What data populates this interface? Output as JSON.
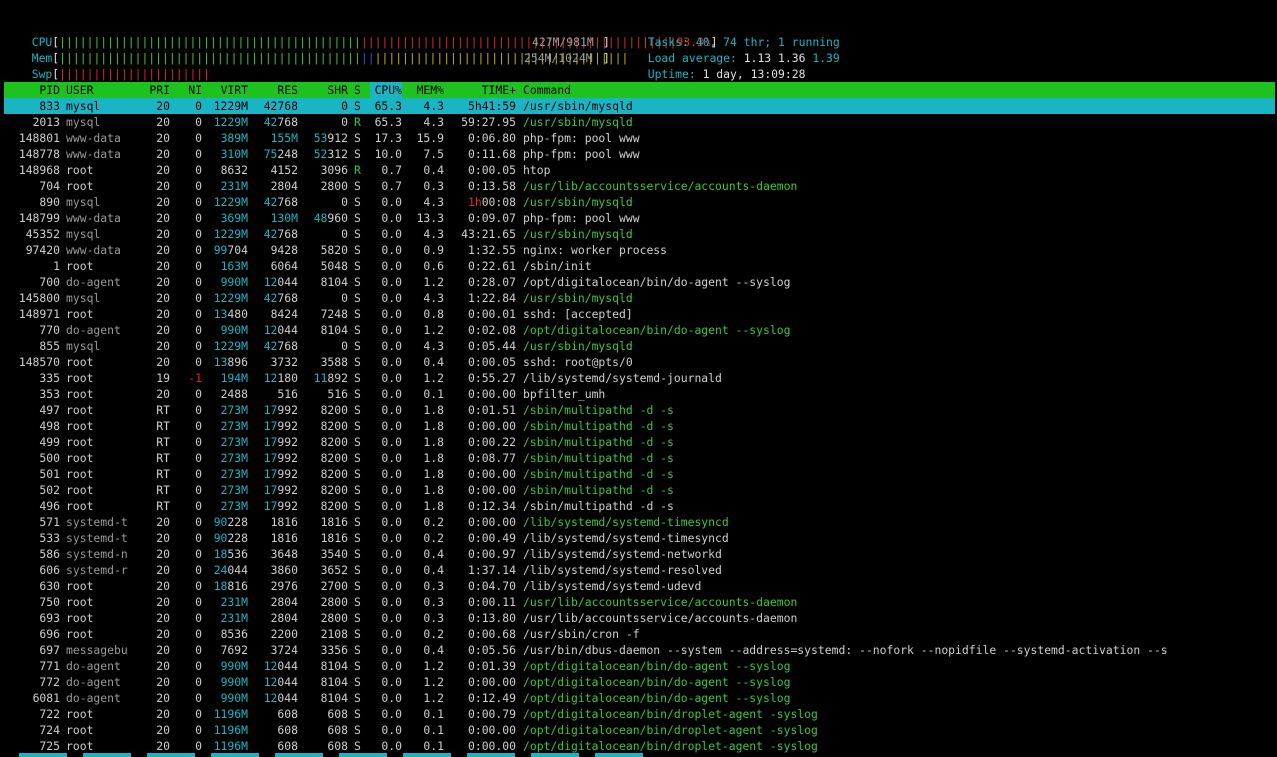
{
  "meters": {
    "cpu": {
      "label": "CPU",
      "pct": "93.3%",
      "green_bar": "||||||||||||||||||||||||||||||||||||||||||||",
      "red_bar": "||||||||||||||||||||||||||||||||||||||||||||||"
    },
    "mem": {
      "label": "Mem",
      "value": "427M/981M",
      "green_bar": "||||||||||||||||||||||||||||||||||||||||||||",
      "blue_bar": "||",
      "yellow_bar": "|||||||||||||||||||||||||||||||||||||"
    },
    "swp": {
      "label": "Swp",
      "value": "254M/1024M",
      "red_bar": "||||||||||||||||||||||"
    }
  },
  "summary": {
    "tasks_label": "Tasks: ",
    "tasks_total": "40",
    "tasks_sep1": ", ",
    "threads": "74",
    "threads_label": " thr; ",
    "running": "1",
    "running_label": " running",
    "load_label": "Load average: ",
    "load1": "1.13",
    "load5": "1.36",
    "load15": "1.39",
    "uptime_label": "Uptime: ",
    "uptime_value": "1 day, 13:09:28"
  },
  "columns": {
    "pid": "PID",
    "user": "USER",
    "pri": "PRI",
    "ni": "NI",
    "virt": "VIRT",
    "res": "RES",
    "shr": "SHR",
    "s": "S",
    "cpu": "CPU%",
    "mem": "MEM%",
    "time": "TIME+",
    "cmd": "Command"
  },
  "processes": [
    {
      "pid": "833",
      "user": "mysql",
      "pri": "20",
      "ni": "0",
      "virt": "1229M",
      "res": "42768",
      "shr": "0",
      "s": "S",
      "cpu": "65.3",
      "mem": "4.3",
      "time": "5h41:59",
      "cmd": "/usr/sbin/mysqld"
    },
    {
      "pid": "2013",
      "user": "mysql",
      "pri": "20",
      "ni": "0",
      "virt": "1229M",
      "res": "42768",
      "shr": "0",
      "s": "R",
      "cpu": "65.3",
      "mem": "4.3",
      "time": "59:27.95",
      "cmd": "/usr/sbin/mysqld"
    },
    {
      "pid": "148801",
      "user": "www-data",
      "pri": "20",
      "ni": "0",
      "virt": "389M",
      "res": "155M",
      "shr": "53912",
      "s": "S",
      "cpu": "17.3",
      "mem": "15.9",
      "time": "0:06.80",
      "cmd": "php-fpm: pool www"
    },
    {
      "pid": "148778",
      "user": "www-data",
      "pri": "20",
      "ni": "0",
      "virt": "310M",
      "res": "75248",
      "shr": "52312",
      "s": "S",
      "cpu": "10.0",
      "mem": "7.5",
      "time": "0:11.68",
      "cmd": "php-fpm: pool www"
    },
    {
      "pid": "148968",
      "user": "root",
      "pri": "20",
      "ni": "0",
      "virt": "8632",
      "res": "4152",
      "shr": "3096",
      "s": "R",
      "cpu": "0.7",
      "mem": "0.4",
      "time": "0:00.05",
      "cmd": "htop"
    },
    {
      "pid": "704",
      "user": "root",
      "pri": "20",
      "ni": "0",
      "virt": "231M",
      "res": "2804",
      "shr": "2800",
      "s": "S",
      "cpu": "0.7",
      "mem": "0.3",
      "time": "0:13.58",
      "cmd": "/usr/lib/accountsservice/accounts-daemon"
    },
    {
      "pid": "890",
      "user": "mysql",
      "pri": "20",
      "ni": "0",
      "virt": "1229M",
      "res": "42768",
      "shr": "0",
      "s": "S",
      "cpu": "0.0",
      "mem": "4.3",
      "time": "1h00:08",
      "cmd": "/usr/sbin/mysqld"
    },
    {
      "pid": "148799",
      "user": "www-data",
      "pri": "20",
      "ni": "0",
      "virt": "369M",
      "res": "130M",
      "shr": "48960",
      "s": "S",
      "cpu": "0.0",
      "mem": "13.3",
      "time": "0:09.07",
      "cmd": "php-fpm: pool www"
    },
    {
      "pid": "45352",
      "user": "mysql",
      "pri": "20",
      "ni": "0",
      "virt": "1229M",
      "res": "42768",
      "shr": "0",
      "s": "S",
      "cpu": "0.0",
      "mem": "4.3",
      "time": "43:21.65",
      "cmd": "/usr/sbin/mysqld"
    },
    {
      "pid": "97420",
      "user": "www-data",
      "pri": "20",
      "ni": "0",
      "virt": "99704",
      "res": "9428",
      "shr": "5820",
      "s": "S",
      "cpu": "0.0",
      "mem": "0.9",
      "time": "1:32.55",
      "cmd": "nginx: worker process"
    },
    {
      "pid": "1",
      "user": "root",
      "pri": "20",
      "ni": "0",
      "virt": "163M",
      "res": "6064",
      "shr": "5048",
      "s": "S",
      "cpu": "0.0",
      "mem": "0.6",
      "time": "0:22.61",
      "cmd": "/sbin/init"
    },
    {
      "pid": "700",
      "user": "do-agent",
      "pri": "20",
      "ni": "0",
      "virt": "990M",
      "res": "12044",
      "shr": "8104",
      "s": "S",
      "cpu": "0.0",
      "mem": "1.2",
      "time": "0:28.07",
      "cmd": "/opt/digitalocean/bin/do-agent --syslog"
    },
    {
      "pid": "145800",
      "user": "mysql",
      "pri": "20",
      "ni": "0",
      "virt": "1229M",
      "res": "42768",
      "shr": "0",
      "s": "S",
      "cpu": "0.0",
      "mem": "4.3",
      "time": "1:22.84",
      "cmd": "/usr/sbin/mysqld"
    },
    {
      "pid": "148971",
      "user": "root",
      "pri": "20",
      "ni": "0",
      "virt": "13480",
      "res": "8424",
      "shr": "7248",
      "s": "S",
      "cpu": "0.0",
      "mem": "0.8",
      "time": "0:00.01",
      "cmd": "sshd: [accepted]"
    },
    {
      "pid": "770",
      "user": "do-agent",
      "pri": "20",
      "ni": "0",
      "virt": "990M",
      "res": "12044",
      "shr": "8104",
      "s": "S",
      "cpu": "0.0",
      "mem": "1.2",
      "time": "0:02.08",
      "cmd": "/opt/digitalocean/bin/do-agent --syslog"
    },
    {
      "pid": "855",
      "user": "mysql",
      "pri": "20",
      "ni": "0",
      "virt": "1229M",
      "res": "42768",
      "shr": "0",
      "s": "S",
      "cpu": "0.0",
      "mem": "4.3",
      "time": "0:05.44",
      "cmd": "/usr/sbin/mysqld"
    },
    {
      "pid": "148570",
      "user": "root",
      "pri": "20",
      "ni": "0",
      "virt": "13896",
      "res": "3732",
      "shr": "3588",
      "s": "S",
      "cpu": "0.0",
      "mem": "0.4",
      "time": "0:00.05",
      "cmd": "sshd: root@pts/0"
    },
    {
      "pid": "335",
      "user": "root",
      "pri": "19",
      "ni": "-1",
      "virt": "194M",
      "res": "12180",
      "shr": "11892",
      "s": "S",
      "cpu": "0.0",
      "mem": "1.2",
      "time": "0:55.27",
      "cmd": "/lib/systemd/systemd-journald"
    },
    {
      "pid": "353",
      "user": "root",
      "pri": "20",
      "ni": "0",
      "virt": "2488",
      "res": "516",
      "shr": "516",
      "s": "S",
      "cpu": "0.0",
      "mem": "0.1",
      "time": "0:00.00",
      "cmd": "bpfilter_umh"
    },
    {
      "pid": "497",
      "user": "root",
      "pri": "RT",
      "ni": "0",
      "virt": "273M",
      "res": "17992",
      "shr": "8200",
      "s": "S",
      "cpu": "0.0",
      "mem": "1.8",
      "time": "0:01.51",
      "cmd": "/sbin/multipathd -d -s"
    },
    {
      "pid": "498",
      "user": "root",
      "pri": "RT",
      "ni": "0",
      "virt": "273M",
      "res": "17992",
      "shr": "8200",
      "s": "S",
      "cpu": "0.0",
      "mem": "1.8",
      "time": "0:00.00",
      "cmd": "/sbin/multipathd -d -s"
    },
    {
      "pid": "499",
      "user": "root",
      "pri": "RT",
      "ni": "0",
      "virt": "273M",
      "res": "17992",
      "shr": "8200",
      "s": "S",
      "cpu": "0.0",
      "mem": "1.8",
      "time": "0:00.22",
      "cmd": "/sbin/multipathd -d -s"
    },
    {
      "pid": "500",
      "user": "root",
      "pri": "RT",
      "ni": "0",
      "virt": "273M",
      "res": "17992",
      "shr": "8200",
      "s": "S",
      "cpu": "0.0",
      "mem": "1.8",
      "time": "0:08.77",
      "cmd": "/sbin/multipathd -d -s"
    },
    {
      "pid": "501",
      "user": "root",
      "pri": "RT",
      "ni": "0",
      "virt": "273M",
      "res": "17992",
      "shr": "8200",
      "s": "S",
      "cpu": "0.0",
      "mem": "1.8",
      "time": "0:00.00",
      "cmd": "/sbin/multipathd -d -s"
    },
    {
      "pid": "502",
      "user": "root",
      "pri": "RT",
      "ni": "0",
      "virt": "273M",
      "res": "17992",
      "shr": "8200",
      "s": "S",
      "cpu": "0.0",
      "mem": "1.8",
      "time": "0:00.00",
      "cmd": "/sbin/multipathd -d -s"
    },
    {
      "pid": "496",
      "user": "root",
      "pri": "RT",
      "ni": "0",
      "virt": "273M",
      "res": "17992",
      "shr": "8200",
      "s": "S",
      "cpu": "0.0",
      "mem": "1.8",
      "time": "0:12.34",
      "cmd": "/sbin/multipathd -d -s"
    },
    {
      "pid": "571",
      "user": "systemd-t",
      "pri": "20",
      "ni": "0",
      "virt": "90228",
      "res": "1816",
      "shr": "1816",
      "s": "S",
      "cpu": "0.0",
      "mem": "0.2",
      "time": "0:00.00",
      "cmd": "/lib/systemd/systemd-timesyncd"
    },
    {
      "pid": "533",
      "user": "systemd-t",
      "pri": "20",
      "ni": "0",
      "virt": "90228",
      "res": "1816",
      "shr": "1816",
      "s": "S",
      "cpu": "0.0",
      "mem": "0.2",
      "time": "0:00.49",
      "cmd": "/lib/systemd/systemd-timesyncd"
    },
    {
      "pid": "586",
      "user": "systemd-n",
      "pri": "20",
      "ni": "0",
      "virt": "18536",
      "res": "3648",
      "shr": "3540",
      "s": "S",
      "cpu": "0.0",
      "mem": "0.4",
      "time": "0:00.97",
      "cmd": "/lib/systemd/systemd-networkd"
    },
    {
      "pid": "606",
      "user": "systemd-r",
      "pri": "20",
      "ni": "0",
      "virt": "24044",
      "res": "3860",
      "shr": "3652",
      "s": "S",
      "cpu": "0.0",
      "mem": "0.4",
      "time": "1:37.14",
      "cmd": "/lib/systemd/systemd-resolved"
    },
    {
      "pid": "630",
      "user": "root",
      "pri": "20",
      "ni": "0",
      "virt": "18816",
      "res": "2976",
      "shr": "2700",
      "s": "S",
      "cpu": "0.0",
      "mem": "0.3",
      "time": "0:04.70",
      "cmd": "/lib/systemd/systemd-udevd"
    },
    {
      "pid": "750",
      "user": "root",
      "pri": "20",
      "ni": "0",
      "virt": "231M",
      "res": "2804",
      "shr": "2800",
      "s": "S",
      "cpu": "0.0",
      "mem": "0.3",
      "time": "0:00.11",
      "cmd": "/usr/lib/accountsservice/accounts-daemon"
    },
    {
      "pid": "693",
      "user": "root",
      "pri": "20",
      "ni": "0",
      "virt": "231M",
      "res": "2804",
      "shr": "2800",
      "s": "S",
      "cpu": "0.0",
      "mem": "0.3",
      "time": "0:13.80",
      "cmd": "/usr/lib/accountsservice/accounts-daemon"
    },
    {
      "pid": "696",
      "user": "root",
      "pri": "20",
      "ni": "0",
      "virt": "8536",
      "res": "2200",
      "shr": "2108",
      "s": "S",
      "cpu": "0.0",
      "mem": "0.2",
      "time": "0:00.68",
      "cmd": "/usr/sbin/cron -f"
    },
    {
      "pid": "697",
      "user": "messagebu",
      "pri": "20",
      "ni": "0",
      "virt": "7692",
      "res": "3724",
      "shr": "3356",
      "s": "S",
      "cpu": "0.0",
      "mem": "0.4",
      "time": "0:05.56",
      "cmd": "/usr/bin/dbus-daemon --system --address=systemd: --nofork --nopidfile --systemd-activation --s"
    },
    {
      "pid": "771",
      "user": "do-agent",
      "pri": "20",
      "ni": "0",
      "virt": "990M",
      "res": "12044",
      "shr": "8104",
      "s": "S",
      "cpu": "0.0",
      "mem": "1.2",
      "time": "0:01.39",
      "cmd": "/opt/digitalocean/bin/do-agent --syslog"
    },
    {
      "pid": "772",
      "user": "do-agent",
      "pri": "20",
      "ni": "0",
      "virt": "990M",
      "res": "12044",
      "shr": "8104",
      "s": "S",
      "cpu": "0.0",
      "mem": "1.2",
      "time": "0:00.00",
      "cmd": "/opt/digitalocean/bin/do-agent --syslog"
    },
    {
      "pid": "6081",
      "user": "do-agent",
      "pri": "20",
      "ni": "0",
      "virt": "990M",
      "res": "12044",
      "shr": "8104",
      "s": "S",
      "cpu": "0.0",
      "mem": "1.2",
      "time": "0:12.49",
      "cmd": "/opt/digitalocean/bin/do-agent --syslog"
    },
    {
      "pid": "722",
      "user": "root",
      "pri": "20",
      "ni": "0",
      "virt": "1196M",
      "res": "608",
      "shr": "608",
      "s": "S",
      "cpu": "0.0",
      "mem": "0.1",
      "time": "0:00.79",
      "cmd": "/opt/digitalocean/bin/droplet-agent -syslog"
    },
    {
      "pid": "724",
      "user": "root",
      "pri": "20",
      "ni": "0",
      "virt": "1196M",
      "res": "608",
      "shr": "608",
      "s": "S",
      "cpu": "0.0",
      "mem": "0.1",
      "time": "0:00.00",
      "cmd": "/opt/digitalocean/bin/droplet-agent -syslog"
    },
    {
      "pid": "725",
      "user": "root",
      "pri": "20",
      "ni": "0",
      "virt": "1196M",
      "res": "608",
      "shr": "608",
      "s": "S",
      "cpu": "0.0",
      "mem": "0.1",
      "time": "0:00.00",
      "cmd": "/opt/digitalocean/bin/droplet-agent -syslog"
    }
  ],
  "colors": {
    "header_bg": "#1ec21e",
    "selection_bg": "#19b5c4",
    "thread_cmd": "#3cc83c"
  }
}
